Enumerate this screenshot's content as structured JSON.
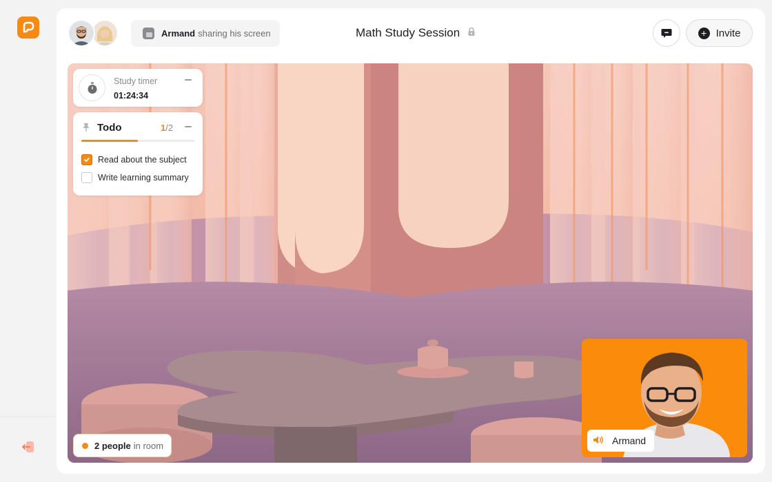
{
  "app": {
    "accent_color": "#F68A12",
    "logo_icon": "app-logo-icon",
    "leave_icon": "leave-room-icon"
  },
  "header": {
    "avatars": [
      {
        "name": "avatar-man",
        "alt": "participant avatar"
      },
      {
        "name": "avatar-woman",
        "alt": "participant avatar"
      }
    ],
    "share_status": {
      "user": "Armand",
      "text": "sharing his screen"
    },
    "title": "Math Study Session",
    "lock_icon": "lock-icon",
    "chat_icon": "chat-icon",
    "invite_label": "Invite",
    "invite_icon": "plus-icon"
  },
  "widgets": {
    "timer": {
      "label": "Study timer",
      "value": "01:24:34"
    },
    "todo": {
      "title": "Todo",
      "done_count": "1",
      "total_count": "/2",
      "progress": 0.5,
      "items": [
        {
          "label": "Read about the subject",
          "checked": true
        },
        {
          "label": "Write learning summary",
          "checked": false
        }
      ]
    }
  },
  "room": {
    "count_text": "2 people",
    "suffix_text": "in room"
  },
  "camera": {
    "name": "Armand",
    "tile_color": "#FB8C0B",
    "speaker_icon": "speaker-icon"
  }
}
